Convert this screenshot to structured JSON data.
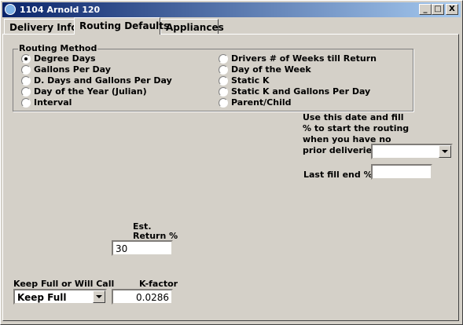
{
  "window": {
    "title": "1104 Arnold 120",
    "controls": {
      "minimize": "_",
      "maximize": "□",
      "close": "X"
    }
  },
  "tabs": [
    {
      "label": "Delivery Info."
    },
    {
      "label": "Routing Defaults",
      "active": true
    },
    {
      "label": "Appliances"
    }
  ],
  "routing": {
    "group_label": "Routing Method",
    "selected": "Degree Days",
    "left_options": [
      "Degree Days",
      "Gallons Per Day",
      "D. Days and Gallons Per Day",
      "Day of the Year (Julian)",
      "Interval"
    ],
    "right_options": [
      "Drivers # of Weeks till Return",
      "Day of the Week",
      "Static K",
      "Static K and Gallons Per Day",
      "Parent/Child"
    ]
  },
  "fill": {
    "label_lines": [
      "Use this date and fill",
      "% to start the routing",
      "when you have no",
      "prior deliveries"
    ],
    "dropdown_value": "",
    "last_fill_label": "Last fill end %",
    "last_fill_value": ""
  },
  "est_return": {
    "label_line1": "Est.",
    "label_line2": "Return %",
    "value": "30"
  },
  "keep_full": {
    "label": "Keep Full or Will Call",
    "value": "Keep Full"
  },
  "kfactor": {
    "label": "K-factor",
    "value": "0.0286"
  },
  "colors": {
    "face": "#d4d0c8",
    "title_start": "#0a246a",
    "title_end": "#a6caf0"
  }
}
